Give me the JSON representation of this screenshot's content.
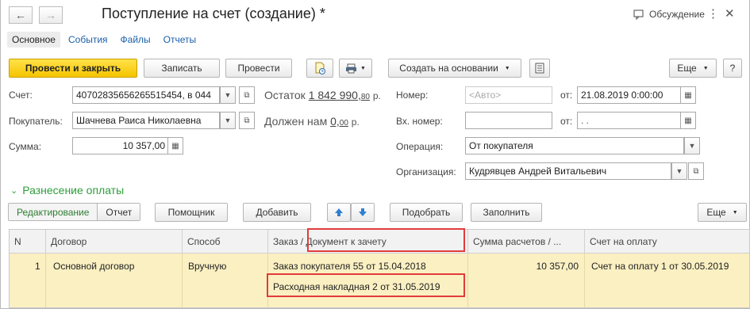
{
  "window": {
    "title": "Поступление на счет (создание) *",
    "discussion": "Обсуждение"
  },
  "nav": {
    "back": "←",
    "forward": "→"
  },
  "tabs": [
    "Основное",
    "События",
    "Файлы",
    "Отчеты"
  ],
  "toolbar": {
    "post_close": "Провести и закрыть",
    "write": "Записать",
    "post": "Провести",
    "create_basis": "Создать на основании",
    "more": "Еще",
    "help": "?"
  },
  "form": {
    "account_label": "Счет:",
    "account_value": "40702835656265515454, в 044",
    "balance_label": "Остаток",
    "balance_value": "1 842 990,",
    "balance_kop": "80",
    "balance_cur": "р.",
    "buyer_label": "Покупатель:",
    "buyer_value": "Шачнева Раиса Николаевна",
    "owed_label": "Должен нам",
    "owed_value": "0,",
    "owed_kop": "00",
    "owed_cur": "р.",
    "sum_label": "Сумма:",
    "sum_value": "10 357,00",
    "number_label": "Номер:",
    "number_placeholder": "<Авто>",
    "from_label": "от:",
    "date_value": "21.08.2019  0:00:00",
    "in_number_label": "Вх. номер:",
    "in_from_label": "от:",
    "in_date_value": ".  .",
    "operation_label": "Операция:",
    "operation_value": "От покупателя",
    "org_label": "Организация:",
    "org_value": "Кудрявцев Андрей Витальевич"
  },
  "section": {
    "title": "Разнесение оплаты",
    "mode_edit": "Редактирование",
    "mode_report": "Отчет",
    "assistant": "Помощник",
    "add": "Добавить",
    "pick": "Подобрать",
    "fill": "Заполнить",
    "more": "Еще"
  },
  "table": {
    "columns": [
      "N",
      "Договор",
      "Способ",
      "Заказ / Документ к зачету",
      "Сумма расчетов / ...",
      "Счет на оплату"
    ],
    "rows": [
      {
        "n": "1",
        "contract": "Основной договор",
        "method": "Вручную",
        "order": "Заказ покупателя 55 от 15.04.2018",
        "document": "Расходная накладная 2 от 31.05.2019",
        "amount": "10 357,00",
        "invoice": "Счет на оплату 1 от 30.05.2019"
      }
    ]
  },
  "colors": {
    "primary": "#f5c400",
    "highlight_row": "#fbf0c2",
    "section_green": "#2e9e3c",
    "callout_red": "#e23b3b"
  }
}
